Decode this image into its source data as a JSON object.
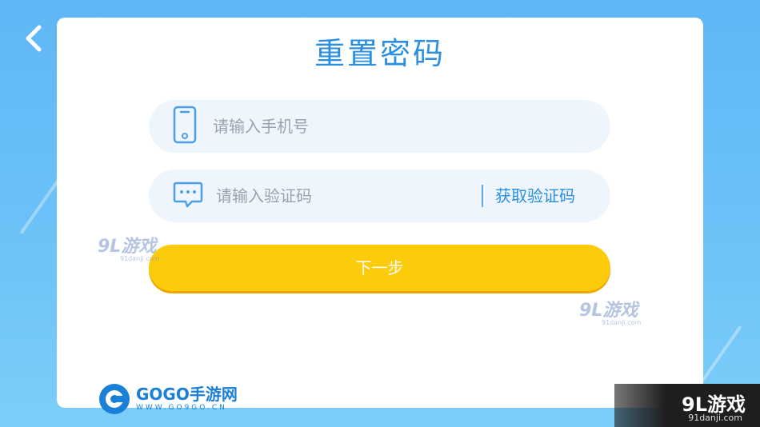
{
  "page": {
    "title": "重置密码"
  },
  "phone_field": {
    "placeholder": "请输入手机号",
    "icon": "phone-icon"
  },
  "code_field": {
    "placeholder": "请输入验证码",
    "icon": "message-icon",
    "get_code_label": "获取验证码"
  },
  "next_button": {
    "label": "下一步"
  },
  "watermarks": {
    "wm1_main": "9L游戏",
    "wm1_sub": "91danji.com",
    "wm2_main": "9L游戏",
    "wm2_sub": "91danji.com"
  },
  "gogo_logo": {
    "name": "GOGO手游网",
    "url_text": "WWW.GO9GO.CN"
  },
  "brand_corner": {
    "main": "9L游戏",
    "sub": "91danji.com"
  },
  "colors": {
    "background": "#6cc2f7",
    "title": "#2a8fe0",
    "field_bg": "#eef5fc",
    "button": "#fccb0c"
  }
}
